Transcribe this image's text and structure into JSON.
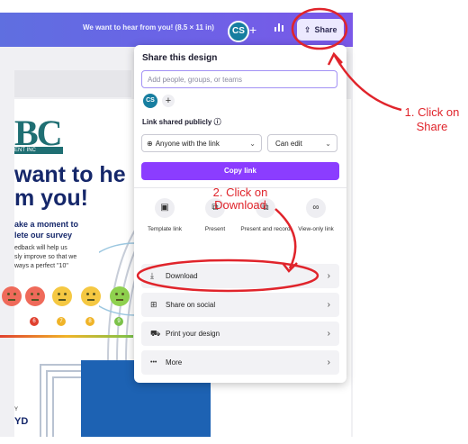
{
  "topbar": {
    "title": "We want to hear from you! (8.5 × 11 in)",
    "collaborator_initials": "CS",
    "add_icon": "+",
    "stats_icon": "bar-chart-icon",
    "share_label": "Share"
  },
  "design": {
    "logo_text": "BC",
    "logo_sub": "ENT INC",
    "heading_line1": "want to he",
    "heading_line2": "m you!",
    "sub_line1": "ake a moment to",
    "sub_line2": "lete our survey",
    "body_line1": "edback will help us",
    "body_line2": "sly improve so that we",
    "body_line3": "ways a perfect \"10\"",
    "ratings": [
      "6",
      "7",
      "8",
      "9"
    ],
    "footer_label": "Y",
    "footer_text": "YD"
  },
  "panel": {
    "title": "Share this design",
    "input_placeholder": "Add people, groups, or teams",
    "avatar_initials": "CS",
    "add_icon": "+",
    "link_label": "Link shared publicly ⓘ",
    "access_select": "Anyone with the link",
    "permission_select": "Can edit",
    "copy_link": "Copy link",
    "options": [
      {
        "icon": "template-icon",
        "glyph": "▣",
        "label": "Template link"
      },
      {
        "icon": "present-icon",
        "glyph": "⧉",
        "label": "Present"
      },
      {
        "icon": "present-record-icon",
        "glyph": "⧉",
        "label": "Present and record"
      },
      {
        "icon": "link-icon",
        "glyph": "∞",
        "label": "View-only link"
      }
    ],
    "rows": [
      {
        "icon": "download-icon",
        "glyph": "⤓",
        "label": "Download"
      },
      {
        "icon": "share-social-icon",
        "glyph": "⊞",
        "label": "Share on social"
      },
      {
        "icon": "print-icon",
        "glyph": "⛟",
        "label": "Print your design"
      },
      {
        "icon": "more-icon",
        "glyph": "•••",
        "label": "More"
      }
    ],
    "chevron": "›"
  },
  "annotations": {
    "step1_line1": "1. Click on",
    "step1_line2": "Share",
    "step2_line1": "2. Click on",
    "step2_line2": "Download",
    "color": "#e0242b"
  }
}
